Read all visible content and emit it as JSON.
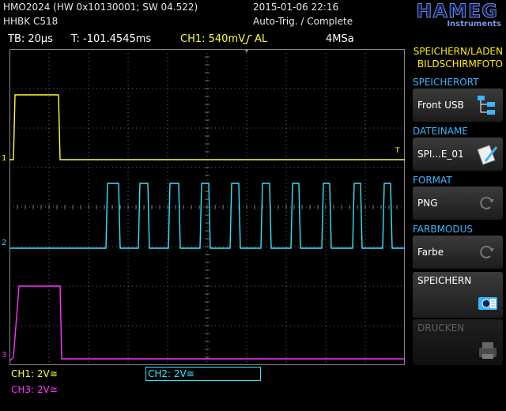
{
  "header": {
    "device": "HMO2024 (HW 0x10130001; SW 04.522)",
    "serial": "HHBK C518",
    "datetime": "2015-01-06 22:16",
    "trigger_status": "Auto-Trig. / Complete",
    "brand": "HAMEG",
    "brand_sub": "Instruments"
  },
  "statusbar": {
    "timebase": "TB: 20µs",
    "trigger_time": "T: -101.4545ms",
    "trigger_channel": "CH1: 540mV",
    "trigger_mode": "AL",
    "sample_rate": "4MSa"
  },
  "markers": {
    "ch1": "1",
    "ch2": "2",
    "ch3": "3",
    "trigger": "T"
  },
  "channels": {
    "ch1": {
      "label": "CH1: 2V≅",
      "color": "#ffff33"
    },
    "ch2": {
      "label": "CH2: 2V≅",
      "color": "#33e5ff"
    },
    "ch3": {
      "label": "CH3: 2V≅",
      "color": "#ff33ff"
    }
  },
  "menu": {
    "title_line1": "SPEICHERN/LADEN",
    "title_line2": "BILDSCHIRMFOTO",
    "storage_label": "SPEICHERORT",
    "storage_value": "Front USB",
    "filename_label": "DATEINAME",
    "filename_value": "SPI...E_01",
    "format_label": "FORMAT",
    "format_value": "PNG",
    "color_label": "FARBMODUS",
    "color_value": "Farbe",
    "save_label": "SPEICHERN",
    "print_label": "DRUCKEN"
  },
  "colors": {
    "grid": "#8a8a8a",
    "accent": "#3ab7ff",
    "menu_title": "#ffee00"
  }
}
